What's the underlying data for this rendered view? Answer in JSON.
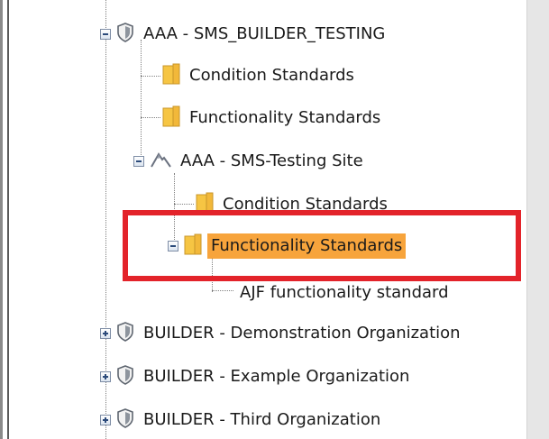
{
  "tree": {
    "items": [
      {
        "label": "AAA - SMS_BUILDER_TESTING",
        "icon": "organization-shield-icon",
        "expander": "minus"
      },
      {
        "label": "Condition Standards",
        "icon": "folder-icon"
      },
      {
        "label": "Functionality Standards",
        "icon": "folder-icon"
      },
      {
        "label": "AAA - SMS-Testing Site",
        "icon": "site-icon",
        "expander": "minus"
      },
      {
        "label": "Condition Standards",
        "icon": "folder-icon"
      },
      {
        "label": "Functionality Standards",
        "icon": "folder-icon",
        "expander": "minus",
        "selected": true
      },
      {
        "label": "AJF functionality standard",
        "icon": "document-icon"
      },
      {
        "label": "BUILDER - Demonstration Organization",
        "icon": "organization-shield-icon",
        "expander": "plus"
      },
      {
        "label": "BUILDER - Example Organization",
        "icon": "organization-shield-icon",
        "expander": "plus"
      },
      {
        "label": "BUILDER - Third Organization",
        "icon": "organization-shield-icon",
        "expander": "plus"
      }
    ]
  },
  "colors": {
    "selected_background": "#f7a43c",
    "annotation_border": "#e3232a",
    "folder_fill": "#f6c543"
  }
}
